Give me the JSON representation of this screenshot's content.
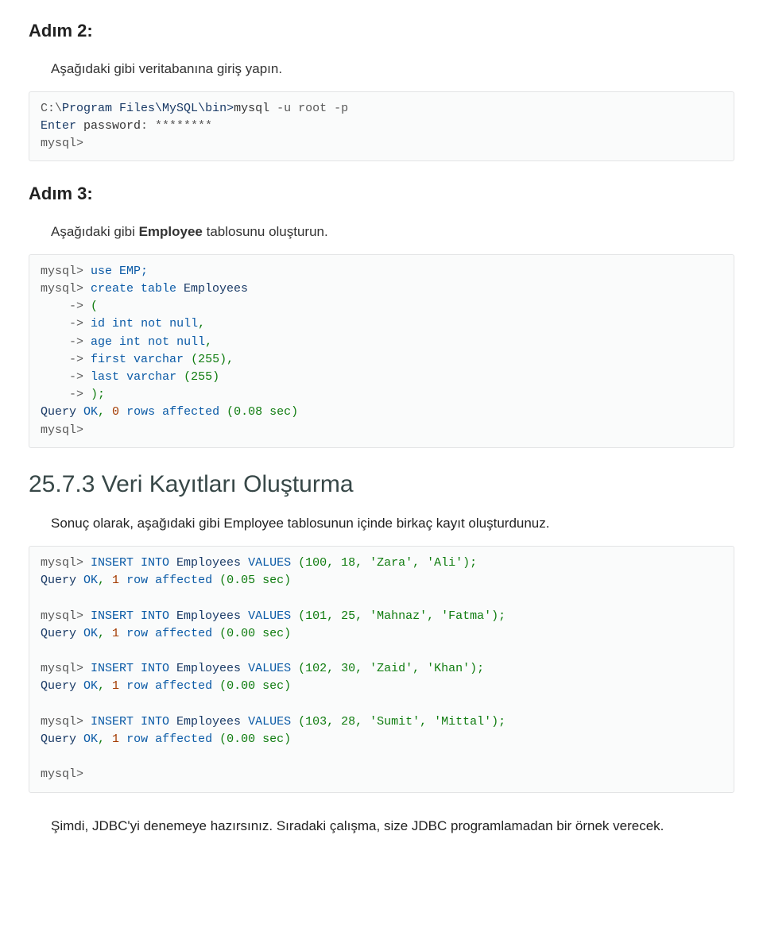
{
  "step2": {
    "heading": "Adım 2:",
    "instruction": "Aşağıdaki gibi veritabanına giriş yapın.",
    "code": {
      "l1a": "C:\\",
      "l1b": "Program",
      "l1c": " ",
      "l1d": "Files\\MySQL\\bin>",
      "l1e": "mysql ",
      "l1f": "-u root -p",
      "l2a": "Enter",
      "l2b": " password",
      "l2c": ": ********",
      "l3": "mysql>"
    }
  },
  "step3": {
    "heading": "Adım 3:",
    "instruction_pre": "Aşağıdaki gibi ",
    "instruction_bold": "Employee",
    "instruction_post": " tablosunu oluşturun.",
    "code": {
      "l1a": "mysql>",
      "l1b": " use EMP;",
      "l2a": "mysql>",
      "l2b": " create table ",
      "l2c": "Employees",
      "l3a": "    ->",
      "l3b": " (",
      "l4a": "    ->",
      "l4b": " id ",
      "l4c": "int",
      "l4d": " not ",
      "l4e": "null",
      "l4f": ",",
      "l5a": "    ->",
      "l5b": " age ",
      "l5c": "int",
      "l5d": " not ",
      "l5e": "null",
      "l5f": ",",
      "l6a": "    ->",
      "l6b": " first varchar ",
      "l6c": "(255),",
      "l7a": "    ->",
      "l7b": " ",
      "l7c": "last",
      "l7d": " varchar ",
      "l7e": "(255)",
      "l8a": "    ->",
      "l8b": " );",
      "l9a": "Query",
      "l9b": " OK",
      "l9c": ", ",
      "l9d": "0",
      "l9e": " rows affected ",
      "l9f": "(0.08 sec)",
      "l10": "mysql>"
    }
  },
  "section": {
    "heading": "25.7.3 Veri Kayıtları Oluşturma",
    "instruction": "Sonuç olarak, aşağıdaki gibi Employee tablosunun içinde birkaç kayıt oluşturdunuz.",
    "code": {
      "r1a": "mysql>",
      "r1b": " INSERT INTO ",
      "r1c": "Employees",
      "r1d": " VALUES ",
      "r1e": "(100, 18, 'Zara', 'Ali');",
      "r1f": "Query",
      "r1g": " OK",
      "r1h": ", ",
      "r1i": "1",
      "r1j": " row affected ",
      "r1k": "(0.05 sec)",
      "r2a": "mysql>",
      "r2b": " INSERT INTO ",
      "r2c": "Employees",
      "r2d": " VALUES ",
      "r2e": "(101, 25, 'Mahnaz', 'Fatma');",
      "r2f": "Query",
      "r2g": " OK",
      "r2h": ", ",
      "r2i": "1",
      "r2j": " row affected ",
      "r2k": "(0.00 sec)",
      "r3a": "mysql>",
      "r3b": " INSERT INTO ",
      "r3c": "Employees",
      "r3d": " VALUES ",
      "r3e": "(102, 30, 'Zaid', 'Khan');",
      "r3f": "Query",
      "r3g": " OK",
      "r3h": ", ",
      "r3i": "1",
      "r3j": " row affected ",
      "r3k": "(0.00 sec)",
      "r4a": "mysql>",
      "r4b": " INSERT INTO ",
      "r4c": "Employees",
      "r4d": " VALUES ",
      "r4e": "(103, 28, 'Sumit', 'Mittal');",
      "r4f": "Query",
      "r4g": " OK",
      "r4h": ", ",
      "r4i": "1",
      "r4j": " row affected ",
      "r4k": "(0.00 sec)",
      "r5": "mysql>"
    }
  },
  "closing": "Şimdi, JDBC'yi denemeye hazırsınız. Sıradaki çalışma, size JDBC programlamadan bir örnek verecek."
}
